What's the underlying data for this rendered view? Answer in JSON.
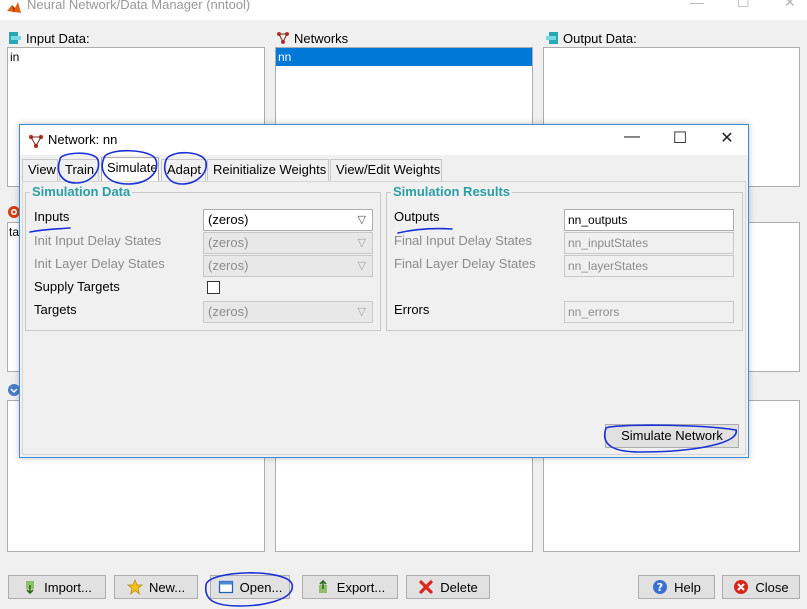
{
  "window": {
    "title": "Neural Network/Data Manager (nntool)"
  },
  "panels": {
    "input_data": {
      "label": "Input Data:",
      "items": [
        "in"
      ]
    },
    "networks": {
      "label": "Networks",
      "items": [
        "nn"
      ],
      "selected": "nn"
    },
    "output_data": {
      "label": "Output Data:",
      "items": []
    },
    "hidden_left": {
      "items": [
        "ta"
      ]
    }
  },
  "buttons": {
    "import": "Import...",
    "new": "New...",
    "open": "Open...",
    "export": "Export...",
    "delete": "Delete",
    "help": "Help",
    "close": "Close"
  },
  "dialog": {
    "title": "Network: nn",
    "tabs": [
      "View",
      "Train",
      "Simulate",
      "Adapt",
      "Reinitialize Weights",
      "View/Edit Weights"
    ],
    "active_tab": "Simulate",
    "simulation_data": {
      "title": "Simulation Data",
      "inputs_label": "Inputs",
      "inputs_value": "(zeros)",
      "init_input_delay_label": "Init Input Delay States",
      "init_input_delay_value": "(zeros)",
      "init_layer_delay_label": "Init Layer Delay States",
      "init_layer_delay_value": "(zeros)",
      "supply_targets_label": "Supply Targets",
      "supply_targets_checked": false,
      "targets_label": "Targets",
      "targets_value": "(zeros)"
    },
    "simulation_results": {
      "title": "Simulation Results",
      "outputs_label": "Outputs",
      "outputs_value": "nn_outputs",
      "final_input_delay_label": "Final Input Delay States",
      "final_input_delay_value": "nn_inputStates",
      "final_layer_delay_label": "Final Layer Delay States",
      "final_layer_delay_value": "nn_layerStates",
      "errors_label": "Errors",
      "errors_value": "nn_errors"
    },
    "simulate_button": "Simulate Network"
  },
  "colors": {
    "accent": "#0078d7",
    "group_title": "#2b9fa5",
    "annotation_ink": "#1a2fd6"
  }
}
